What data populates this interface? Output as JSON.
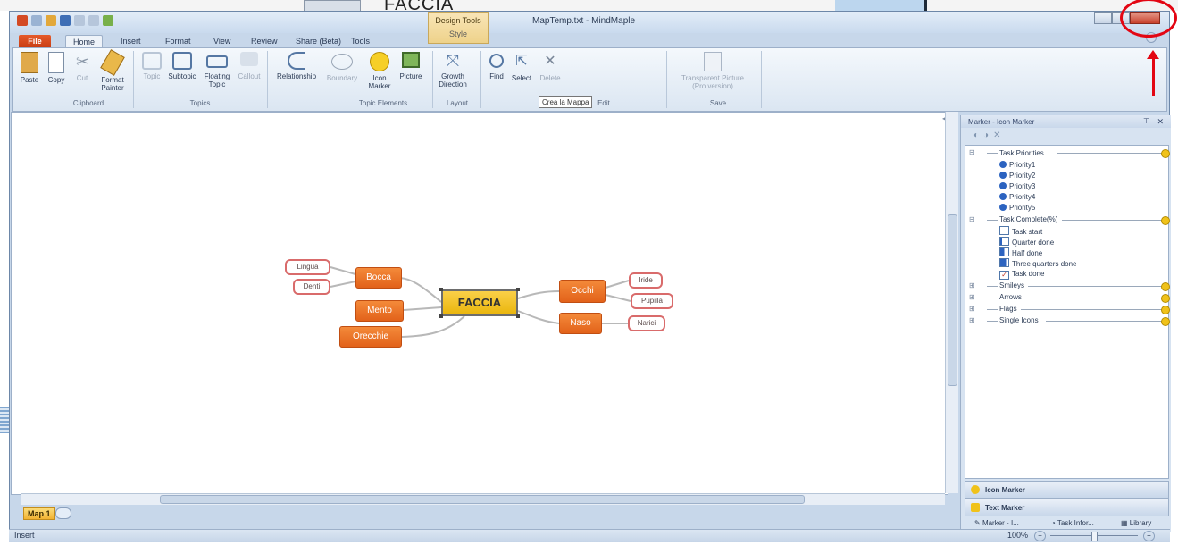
{
  "background": {
    "title": "FACCIA"
  },
  "window": {
    "title": "MapTemp.txt - MindMaple",
    "contextual_tab_group": "Design Tools",
    "contextual_tab": "Style"
  },
  "tabs": [
    "File",
    "Home",
    "Insert",
    "Format",
    "View",
    "Review",
    "Share (Beta)",
    "Tools"
  ],
  "ribbon": {
    "clipboard": {
      "paste": "Paste",
      "copy": "Copy",
      "cut": "Cut",
      "format_painter": [
        "Format",
        "Painter"
      ],
      "group": "Clipboard"
    },
    "topics": {
      "topic": "Topic",
      "subtopic": "Subtopic",
      "floating": [
        "Floating",
        "Topic"
      ],
      "callout": "Callout",
      "group": "Topics"
    },
    "topic_elements": {
      "relationship": "Relationship",
      "boundary": "Boundary",
      "icon_marker": [
        "Icon",
        "Marker"
      ],
      "picture": "Picture",
      "group": "Topic Elements"
    },
    "layout": {
      "growth": [
        "Growth",
        "Direction"
      ],
      "group": "Layout"
    },
    "edit": {
      "find": "Find",
      "select": "Select",
      "delete": "Delete",
      "group": "Edit"
    },
    "save": {
      "transparent": [
        "Transparent Picture",
        "(Pro version)"
      ],
      "group": "Save"
    }
  },
  "tooltip": "Crea la Mappa",
  "mindmap": {
    "central": "FACCIA",
    "topics": [
      "Bocca",
      "Mento",
      "Orecchie",
      "Occhi",
      "Naso"
    ],
    "subtopics": [
      "Lingua",
      "Denti",
      "Iride",
      "Pupilla",
      "Narici"
    ]
  },
  "map_tab": "Map 1",
  "status": {
    "text": "Insert",
    "zoom": "100%"
  },
  "panel": {
    "title": "Marker - Icon Marker",
    "categories": {
      "task_priorities": "Task Priorities",
      "priorities": [
        "Priority1",
        "Priority2",
        "Priority3",
        "Priority4",
        "Priority5"
      ],
      "task_complete": "Task Complete(%)",
      "complete_items": [
        "Task start",
        "Quarter done",
        "Half done",
        "Three quarters done",
        "Task done"
      ],
      "smileys": "Smileys",
      "arrows": "Arrows",
      "flags": "Flags",
      "single_icons": "Single Icons"
    },
    "icon_marker": "Icon Marker",
    "text_marker": "Text Marker",
    "bottom_tabs": [
      "Marker - I...",
      "Task Infor...",
      "Library"
    ]
  }
}
